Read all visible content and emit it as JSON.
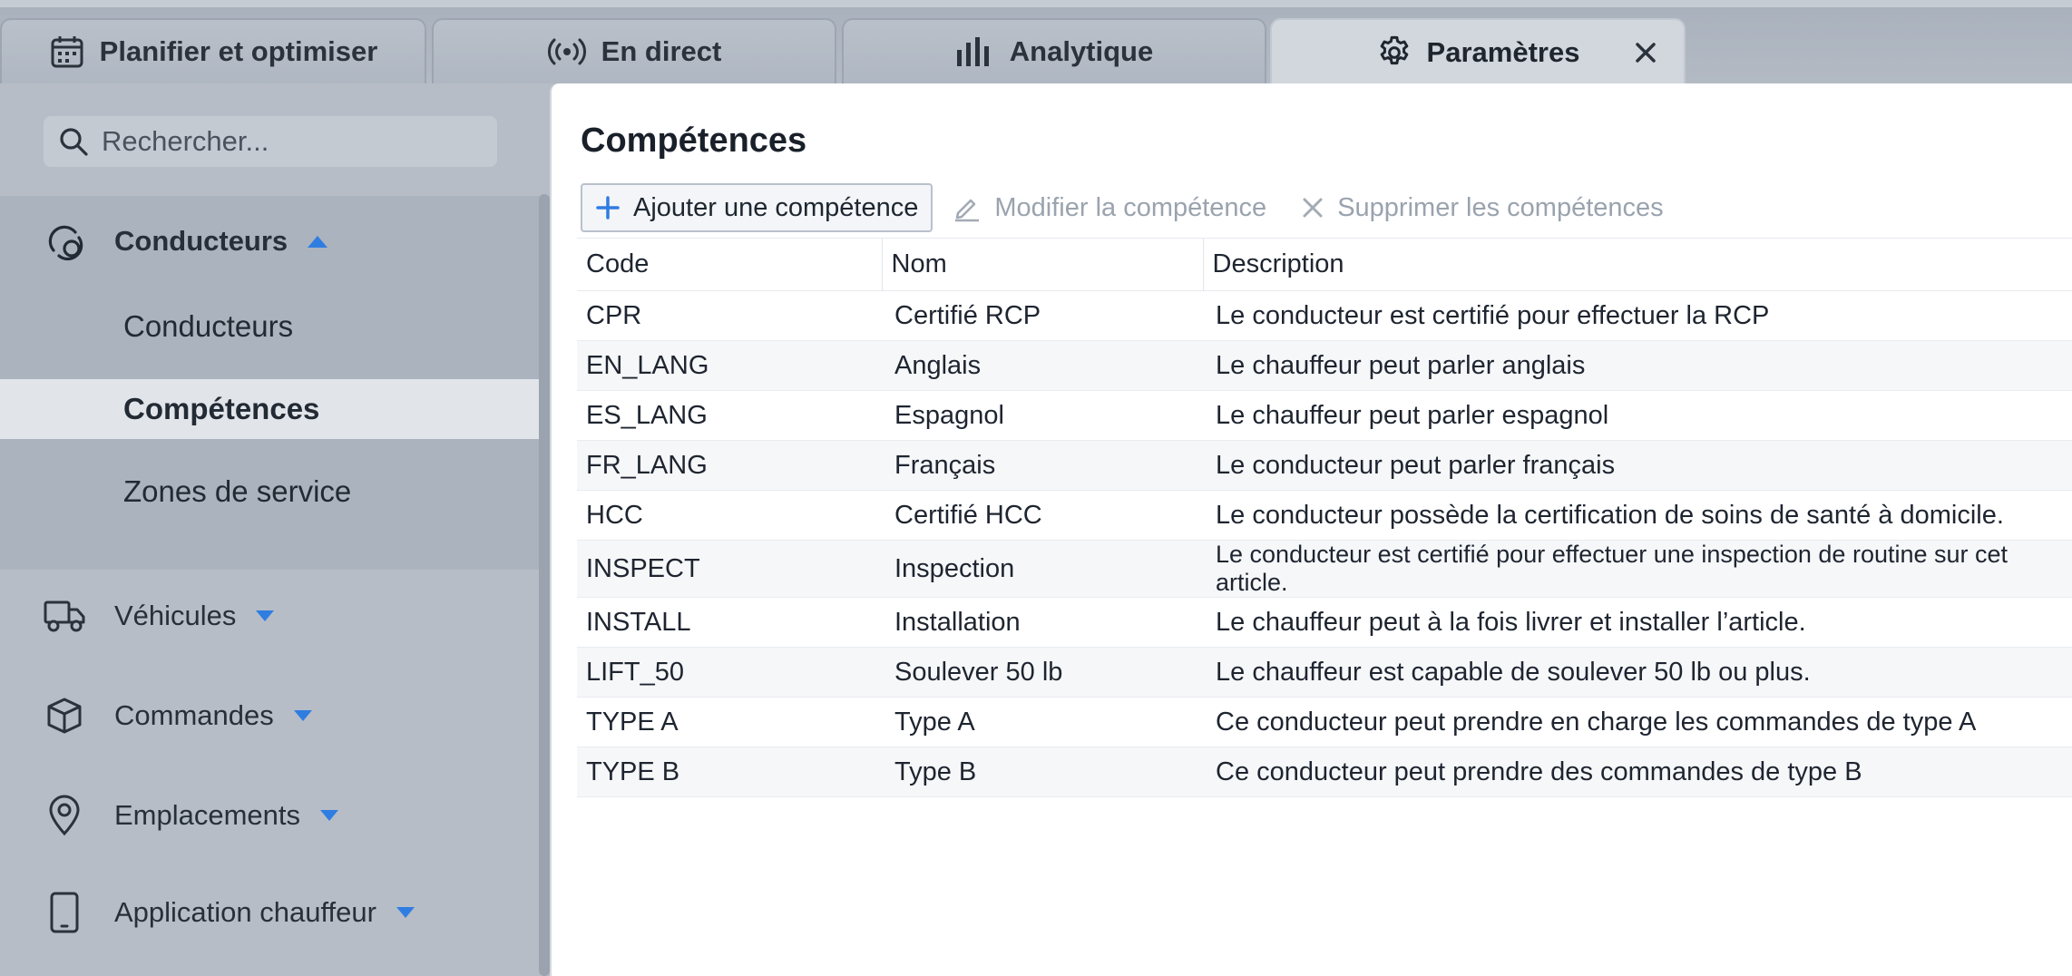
{
  "tabs": [
    {
      "label": "Planifier et optimiser",
      "icon": "calendar-icon"
    },
    {
      "label": "En direct",
      "icon": "broadcast-icon"
    },
    {
      "label": "Analytique",
      "icon": "bar-chart-icon"
    },
    {
      "label": "Paramètres",
      "icon": "gear-icon",
      "active": true
    }
  ],
  "sidebar": {
    "search_placeholder": "Rechercher...",
    "groups": [
      {
        "label": "Conducteurs",
        "icon": "driver-icon",
        "expanded": true,
        "items": [
          {
            "label": "Conducteurs"
          },
          {
            "label": "Compétences",
            "active": true
          },
          {
            "label": "Zones de service"
          }
        ]
      },
      {
        "label": "Véhicules",
        "icon": "truck-icon"
      },
      {
        "label": "Commandes",
        "icon": "package-icon"
      },
      {
        "label": "Emplacements",
        "icon": "location-pin-icon"
      },
      {
        "label": "Application chauffeur",
        "icon": "mobile-icon"
      }
    ]
  },
  "main": {
    "title": "Compétences",
    "toolbar": {
      "add_label": "Ajouter une compétence",
      "edit_label": "Modifier la compétence",
      "delete_label": "Supprimer les compétences"
    },
    "columns": [
      "Code",
      "Nom",
      "Description"
    ],
    "rows": [
      {
        "code": "CPR",
        "name": "Certifié RCP",
        "description": "Le conducteur est certifié pour effectuer la RCP"
      },
      {
        "code": "EN_LANG",
        "name": "Anglais",
        "description": "Le chauffeur peut parler anglais"
      },
      {
        "code": "ES_LANG",
        "name": "Espagnol",
        "description": "Le chauffeur peut parler espagnol"
      },
      {
        "code": "FR_LANG",
        "name": "Français",
        "description": "Le conducteur peut parler français"
      },
      {
        "code": "HCC",
        "name": "Certifié HCC",
        "description": "Le conducteur possède la certification de soins de santé à domicile."
      },
      {
        "code": "INSPECT",
        "name": "Inspection",
        "description": "Le conducteur est certifié pour effectuer une inspection de routine sur cet article."
      },
      {
        "code": "INSTALL",
        "name": "Installation",
        "description": "Le chauffeur peut à la fois livrer et installer l’article."
      },
      {
        "code": "LIFT_50",
        "name": "Soulever 50 lb",
        "description": "Le chauffeur est capable de soulever 50 lb ou plus."
      },
      {
        "code": "TYPE A",
        "name": "Type A",
        "description": "Ce conducteur peut prendre en charge les commandes de type A"
      },
      {
        "code": "TYPE B",
        "name": "Type B",
        "description": "Ce conducteur peut prendre des commandes de type B"
      }
    ]
  },
  "colors": {
    "accent": "#2f7de1",
    "active_item_bg": "#e1e5ea"
  }
}
